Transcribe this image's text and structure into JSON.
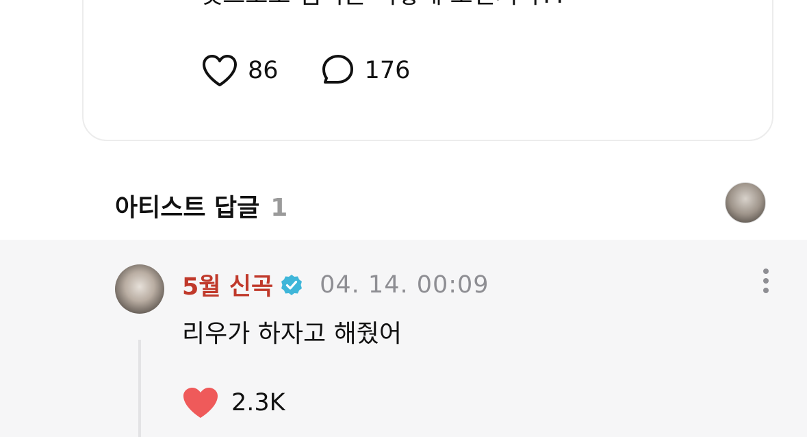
{
  "post": {
    "text": "댓츠노노 멤버는 어떻게 모인거야??",
    "likes": "86",
    "comments": "176"
  },
  "artist_reply_section": {
    "title": "아티스트 답글",
    "count": "1"
  },
  "reply": {
    "author": "5월 신곡",
    "timestamp": "04. 14. 00:09",
    "text": "리우가 하자고 해줬어",
    "likes": "2.3K"
  },
  "colors": {
    "author_name": "#c0392b",
    "verified_badge": "#3fb6d9",
    "heart_filled": "#ef5a5a",
    "reply_background": "#f6f6f7"
  },
  "icons": {
    "like": "heart-outline-icon",
    "comment": "speech-bubble-icon",
    "verified": "verified-badge-icon",
    "more": "more-vertical-icon",
    "reply_like": "heart-filled-icon"
  }
}
